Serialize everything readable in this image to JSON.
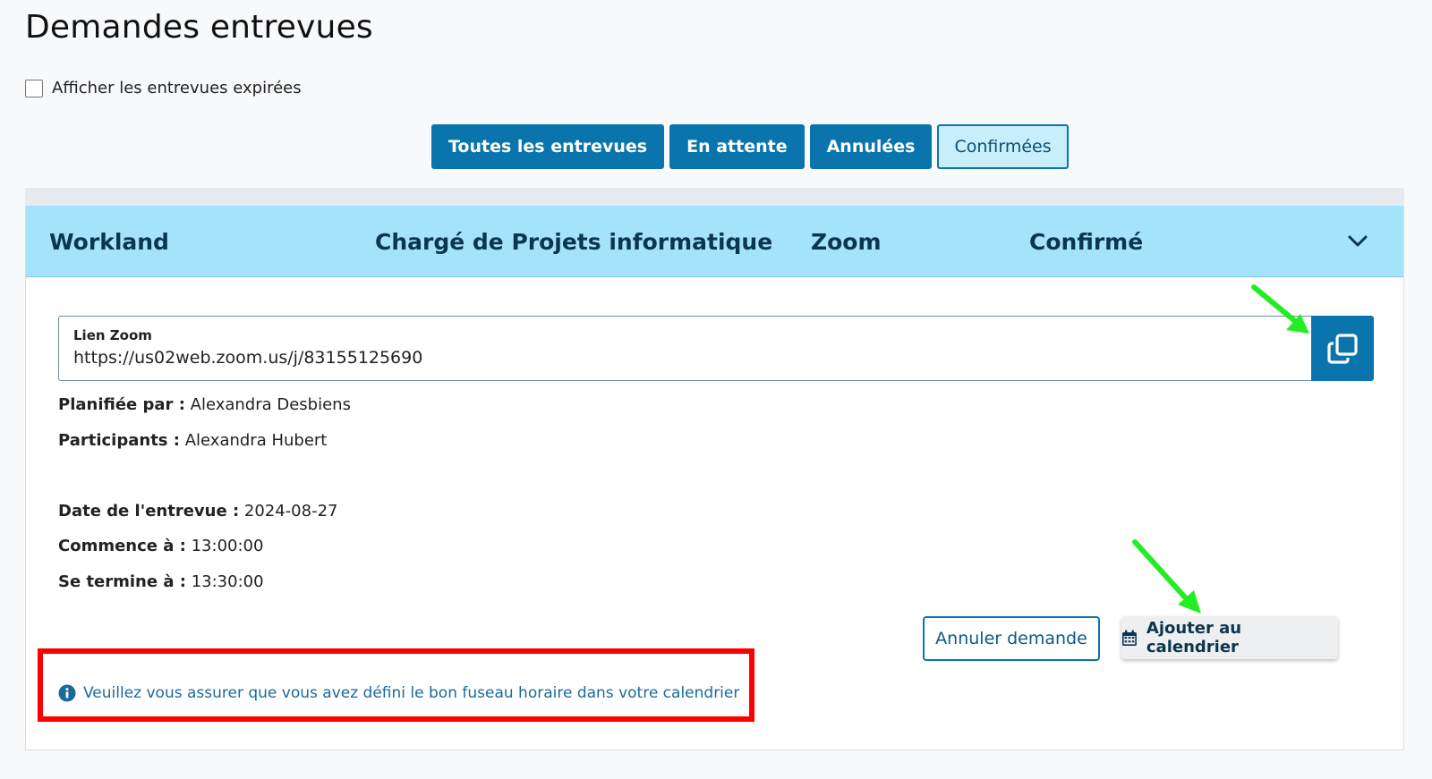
{
  "page": {
    "title": "Demandes entrevues"
  },
  "options": {
    "show_expired_label": "Afficher les entrevues expirées",
    "show_expired_checked": false
  },
  "filters": [
    {
      "label": "Toutes les entrevues",
      "active": false
    },
    {
      "label": "En attente",
      "active": false
    },
    {
      "label": "Annulées",
      "active": false
    },
    {
      "label": "Confirmées",
      "active": true
    }
  ],
  "interview": {
    "company": "Workland",
    "position": "Chargé de Projets informatique",
    "platform": "Zoom",
    "status": "Confirmé",
    "link_label": "Lien Zoom",
    "link_value": "https://us02web.zoom.us/j/83155125690",
    "planned_by_label": "Planifiée par :",
    "planned_by": "Alexandra Desbiens",
    "participants_label": "Participants :",
    "participants": "Alexandra Hubert",
    "date_label": "Date de l'entrevue :",
    "date": "2024-08-27",
    "start_label": "Commence à :",
    "start": "13:00:00",
    "end_label": "Se termine à :",
    "end": "13:30:00",
    "cancel_label": "Annuler demande",
    "calendar_label": "Ajouter au calendrier",
    "notice": "Veuillez vous assurer que vous avez défini le bon fuseau horaire dans votre calendrier"
  },
  "icons": {
    "copy": "copy-icon",
    "calendar": "calendar-icon",
    "info": "info-icon",
    "chevron": "chevron-down-icon"
  },
  "colors": {
    "primary": "#0a75ad",
    "header_bg": "#a5e3fa",
    "highlight": "#ff0000",
    "annotation_arrow": "#22ee22"
  }
}
